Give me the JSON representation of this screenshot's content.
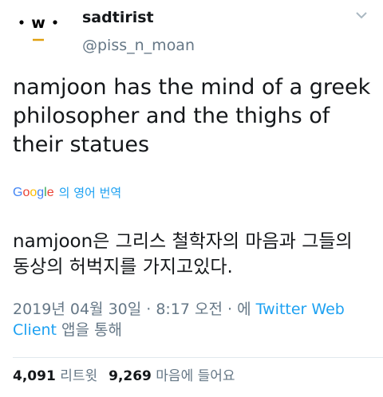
{
  "user": {
    "display_name": "sadtirist",
    "handle": "@piss_n_moan",
    "avatar_icon": "emoji-face-avatar"
  },
  "tweet": {
    "text": "namjoon has the mind of a greek philosopher and the thighs of their statues"
  },
  "translation": {
    "provider": "Google",
    "link_label": "의 영어 번역",
    "text": "namjoon은 그리스 철학자의 마음과 그들의 동상의 허벅지를 가지고있다."
  },
  "meta": {
    "timestamp": "2019년 04월 30일 · 8:17 오전 · ",
    "via_prefix": "에 ",
    "source": "Twitter Web Client",
    "via_suffix": " 앱을 통해"
  },
  "stats": {
    "retweets_count": "4,091",
    "retweets_label": "리트윗",
    "likes_count": "9,269",
    "likes_label": "마음에 들어요"
  },
  "colors": {
    "link": "#1da1f2",
    "secondary": "#657786",
    "text": "#14171a"
  }
}
